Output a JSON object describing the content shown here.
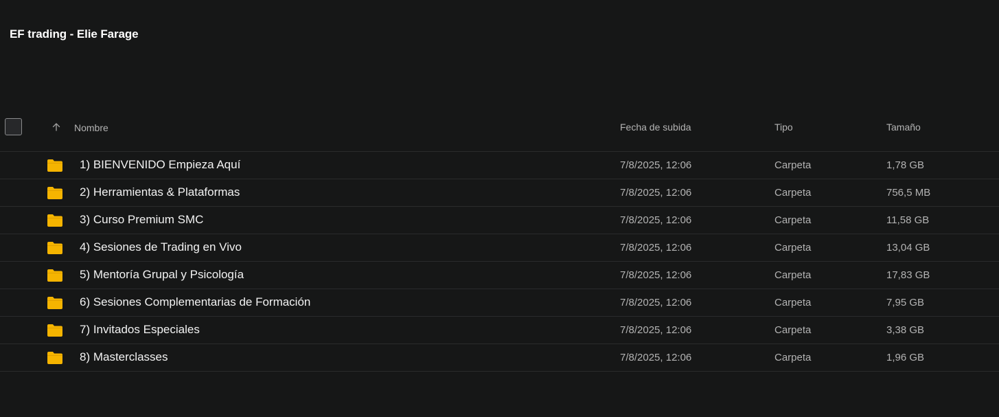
{
  "header": {
    "title": "EF trading - Elie Farage"
  },
  "table": {
    "columns": {
      "name": "Nombre",
      "date": "Fecha de subida",
      "type": "Tipo",
      "size": "Tamaño"
    },
    "rows": [
      {
        "name": "1) BIENVENIDO Empieza Aquí",
        "date": "7/8/2025, 12:06",
        "type": "Carpeta",
        "size": "1,78 GB"
      },
      {
        "name": "2) Herramientas & Plataformas",
        "date": "7/8/2025, 12:06",
        "type": "Carpeta",
        "size": "756,5 MB"
      },
      {
        "name": "3) Curso Premium SMC",
        "date": "7/8/2025, 12:06",
        "type": "Carpeta",
        "size": "11,58 GB"
      },
      {
        "name": "4) Sesiones de Trading en Vivo",
        "date": "7/8/2025, 12:06",
        "type": "Carpeta",
        "size": "13,04 GB"
      },
      {
        "name": "5) Mentoría Grupal y Psicología",
        "date": "7/8/2025, 12:06",
        "type": "Carpeta",
        "size": "17,83 GB"
      },
      {
        "name": "6) Sesiones Complementarias de Formación",
        "date": "7/8/2025, 12:06",
        "type": "Carpeta",
        "size": "7,95 GB"
      },
      {
        "name": "7) Invitados Especiales",
        "date": "7/8/2025, 12:06",
        "type": "Carpeta",
        "size": "3,38 GB"
      },
      {
        "name": "8) Masterclasses",
        "date": "7/8/2025, 12:06",
        "type": "Carpeta",
        "size": "1,96 GB"
      }
    ]
  },
  "icons": {
    "folder": "folder-icon",
    "sort": "arrow-up-icon"
  },
  "colors": {
    "background": "#161717",
    "folder": "#f5b400",
    "divider": "#2a2b2c"
  }
}
